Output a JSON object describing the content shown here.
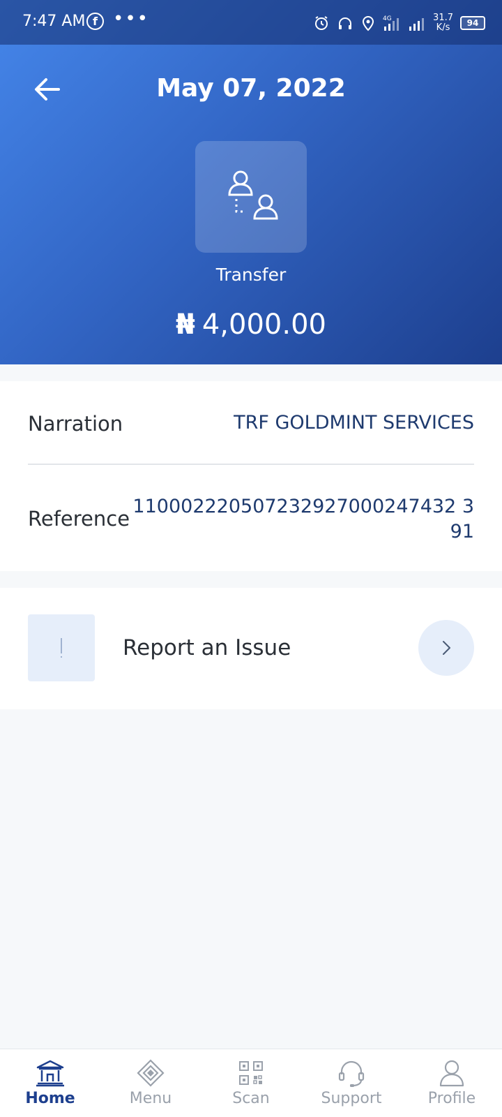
{
  "status_bar": {
    "time": "7:47 AM",
    "network_type": "4G",
    "speed_value": "31.7",
    "speed_unit": "K/s",
    "battery": "94"
  },
  "header": {
    "date": "May 07, 2022",
    "transaction_type": "Transfer",
    "currency_symbol": "₦",
    "amount": "4,000.00"
  },
  "details": {
    "narration_label": "Narration",
    "narration_value": "TRF GOLDMINT SERVICES",
    "reference_label": "Reference",
    "reference_value_line1": "110002220507232927000247432 3",
    "reference_value_line2": "91"
  },
  "report": {
    "label": "Report an Issue",
    "icon": "exclamation-icon"
  },
  "bottom_nav": {
    "items": [
      {
        "label": "Home",
        "icon": "bank-icon",
        "active": true
      },
      {
        "label": "Menu",
        "icon": "diamond-icon",
        "active": false
      },
      {
        "label": "Scan",
        "icon": "qr-code-icon",
        "active": false
      },
      {
        "label": "Support",
        "icon": "headset-icon",
        "active": false
      },
      {
        "label": "Profile",
        "icon": "person-icon",
        "active": false
      }
    ]
  },
  "colors": {
    "header_gradient_start": "#4586ea",
    "header_gradient_end": "#1d3f8e",
    "accent_text": "#1e3a6e",
    "soft_blue": "#e6eefa"
  }
}
